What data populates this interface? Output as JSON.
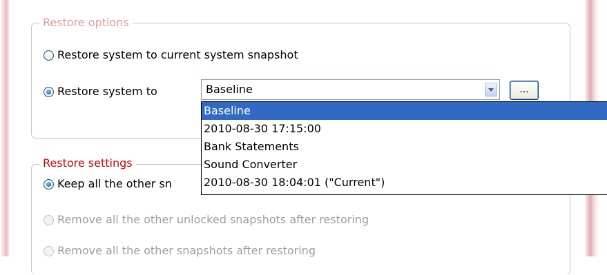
{
  "restore_options": {
    "legend": "Restore options",
    "current_snapshot_label": "Restore system to current system snapshot",
    "restore_to_label": "Restore system to",
    "selected_snapshot": "Baseline",
    "browse_label": "...",
    "snapshot_options": [
      "Baseline",
      "2010-08-30 17:15:00",
      "Bank Statements",
      "Sound Converter",
      "2010-08-30 18:04:01 (\"Current\")"
    ]
  },
  "restore_settings": {
    "legend": "Restore settings",
    "keep_label": "Keep all the other sn",
    "remove_unlocked_label": "Remove all the other unlocked snapshots after restoring",
    "remove_all_label": "Remove all the other snapshots after restoring"
  },
  "colors": {
    "selection": "#316ac5",
    "legend_options": "#e89a9a",
    "legend_settings": "#cc0000"
  }
}
